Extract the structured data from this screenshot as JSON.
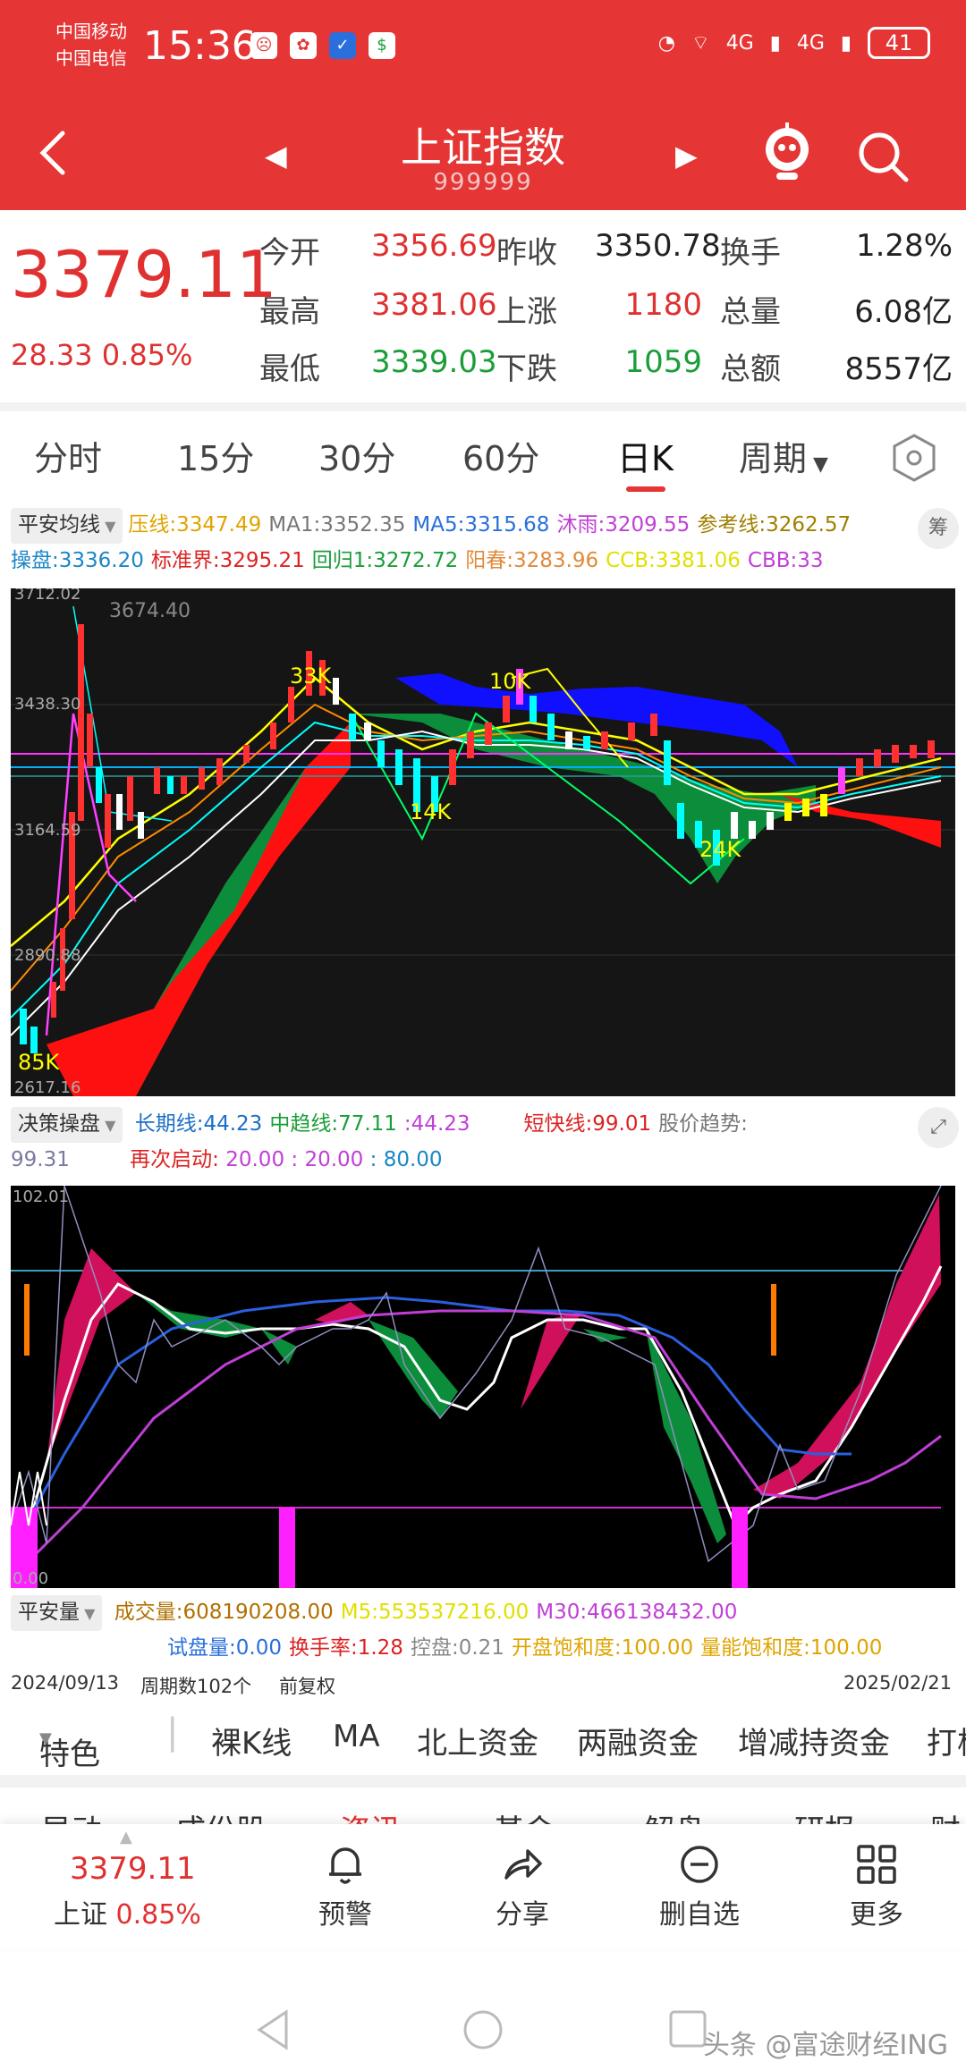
{
  "status": {
    "carrier1": "中国移动",
    "carrier2": "中国电信",
    "time": "15:36",
    "battery": "41",
    "signal1": "4G",
    "signal2": "4G"
  },
  "header": {
    "title": "上证指数",
    "code": "999999"
  },
  "quote": {
    "price": "3379.11",
    "change": "28.33",
    "change_pct": "0.85%",
    "rows": [
      {
        "l1": "今开",
        "v1": "3356.69",
        "l2": "昨收",
        "v2": "3350.78",
        "l3": "换手",
        "v3": "1.28%"
      },
      {
        "l1": "最高",
        "v1": "3381.06",
        "l2": "上涨",
        "v2": "1180",
        "l3": "总量",
        "v3": "6.08亿"
      },
      {
        "l1": "最低",
        "v1": "3339.03",
        "l2": "下跌",
        "v2": "1059",
        "l3": "总额",
        "v3": "8557亿"
      }
    ]
  },
  "tabs": [
    "分时",
    "15分",
    "30分",
    "60分",
    "日K",
    "周期"
  ],
  "ma_panel": {
    "selector": "平安均线",
    "chip": "筹",
    "items": [
      {
        "label": "压线:",
        "value": "3347.49",
        "color": "#e0a400"
      },
      {
        "label": "MA1:",
        "value": "3352.35",
        "color": "#777"
      },
      {
        "label": "MA5:",
        "value": "3315.68",
        "color": "#2a6fdb"
      },
      {
        "label": "沐雨:",
        "value": "3209.55",
        "color": "#c03fd6"
      },
      {
        "label": "参考线:",
        "value": "3262.57",
        "color": "#a08000"
      },
      {
        "label": "操盘:",
        "value": "3336.20",
        "color": "#1a86c6"
      },
      {
        "label": "标准界:",
        "value": "3295.21",
        "color": "#d22"
      },
      {
        "label": "回归1:",
        "value": "3272.72",
        "color": "#1a9e38"
      },
      {
        "label": "阳春:",
        "value": "3283.96",
        "color": "#e08a3a"
      },
      {
        "label": "CCB:",
        "value": "3381.06",
        "color": "#e0e000"
      },
      {
        "label": "CBB:",
        "value": "33",
        "color": "#c03fd6"
      }
    ]
  },
  "kchart": {
    "axis": [
      "3712.02",
      "3438.30",
      "3164.59",
      "2890.88",
      "2617.16"
    ],
    "peak_label": "3674.40",
    "tags": [
      "33K",
      "10K",
      "14K",
      "24K",
      "85K"
    ]
  },
  "decision": {
    "selector": "决策操盘",
    "line1": [
      {
        "label": "长期线:",
        "value": "44.23",
        "color": "#1a6fc6"
      },
      {
        "label": "中趋线:",
        "value": "77.11",
        "color": "#1a9e38"
      },
      {
        "label": ":",
        "value": "44.23",
        "color": "#c03fd6"
      },
      {
        "label": "短快线:",
        "value": "99.01",
        "color": "#d22"
      },
      {
        "label": "股价趋势:",
        "value": "",
        "color": "#777"
      }
    ],
    "trend_value": "99.31",
    "restart_label": "再次启动:",
    "restart_values": [
      "20.00",
      "20.00",
      "80.00"
    ],
    "axis_top": "102.01",
    "axis_bottom": "0.00"
  },
  "volume": {
    "selector": "平安量",
    "items": [
      {
        "label": "成交量:",
        "value": "608190208.00",
        "color": "#b07000"
      },
      {
        "label": "M5:",
        "value": "553537216.00",
        "color": "#e0e000"
      },
      {
        "label": "M30:",
        "value": "466138432.00",
        "color": "#c03fd6"
      }
    ],
    "items2": [
      {
        "label": "试盘量:",
        "value": "0.00",
        "color": "#2a6fdb"
      },
      {
        "label": "换手率:",
        "value": "1.28",
        "color": "#d22"
      },
      {
        "label": "控盘:",
        "value": "0.21",
        "color": "#888"
      },
      {
        "label": "开盘饱和度:",
        "value": "100.00",
        "color": "#e0a400"
      },
      {
        "label": "量能饱和度:",
        "value": "100.00",
        "color": "#e0a400"
      }
    ]
  },
  "dates": {
    "start": "2024/09/13",
    "period_count": "周期数102个",
    "adjust": "前复权",
    "end": "2025/02/21"
  },
  "subtabs": [
    "特色",
    "裸K线",
    "MA",
    "北上资金",
    "两融资金",
    "增减持资金",
    "打板"
  ],
  "peek_tabs": [
    "异动",
    "成份股",
    "资讯",
    "基金",
    "解盘",
    "研报",
    "财务"
  ],
  "bottom": {
    "price": "3379.11",
    "name": "上证",
    "pct": "0.85%",
    "actions": [
      "预警",
      "分享",
      "删自选",
      "更多"
    ]
  },
  "watermark": "头条 @富途财经ING",
  "colors": {
    "brand": "#e53535",
    "up": "#e03131",
    "down": "#1a9e38"
  }
}
